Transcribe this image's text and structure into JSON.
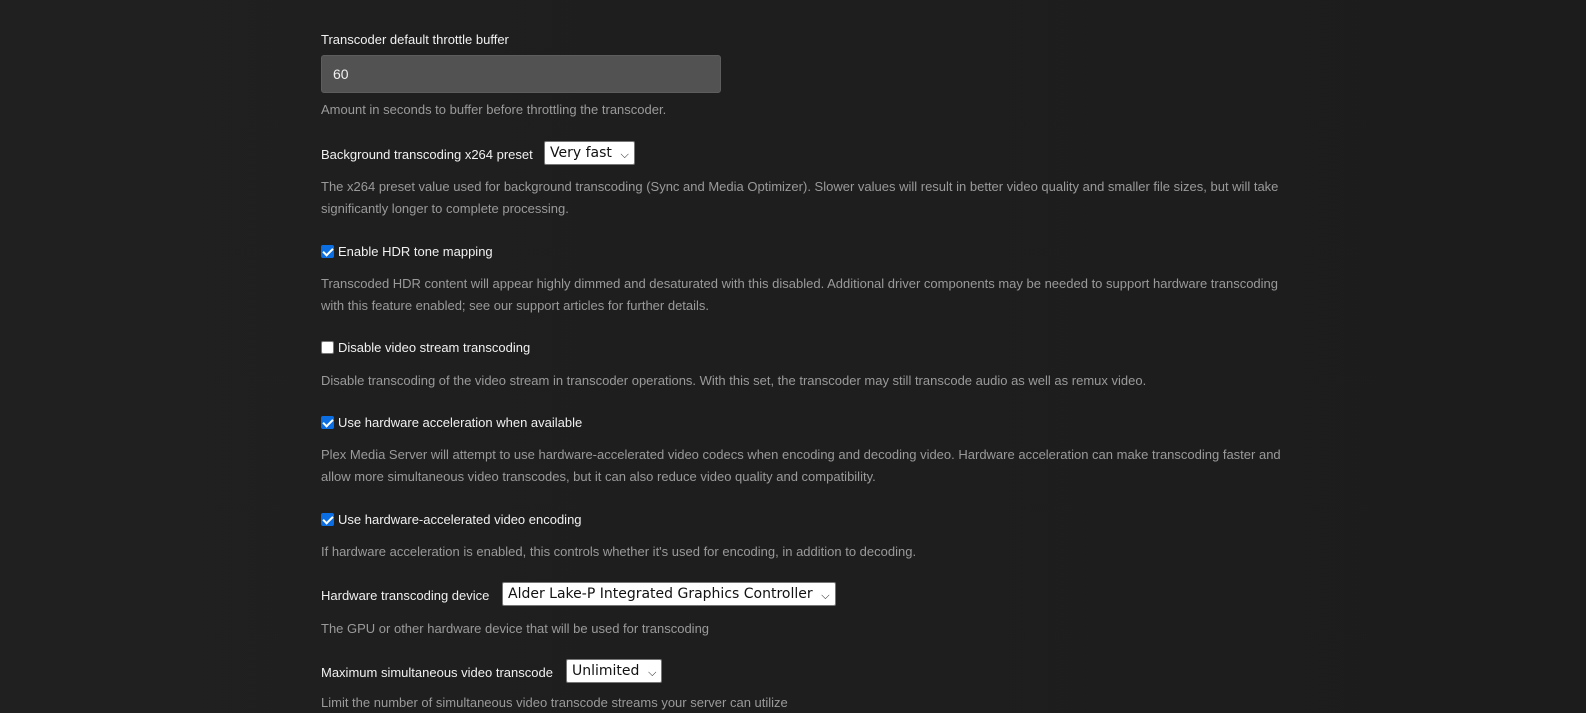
{
  "settings": {
    "throttle": {
      "label": "Transcoder default throttle buffer",
      "value": "60",
      "help": "Amount in seconds to buffer before throttling the transcoder."
    },
    "preset": {
      "label": "Background transcoding x264 preset",
      "selected": "Very fast",
      "help_line1": "The x264 preset value used for background transcoding (Sync and Media Optimizer). Slower values will result in better video quality and smaller file sizes, but will take",
      "help_line2": "significantly longer to complete processing."
    },
    "hdr": {
      "label": "Enable HDR tone mapping",
      "checked": true,
      "help_line1": "Transcoded HDR content will appear highly dimmed and desaturated with this disabled. Additional driver components may be needed to support hardware transcoding",
      "help_line2": "with this feature enabled; see our support articles for further details."
    },
    "disable_video": {
      "label": "Disable video stream transcoding",
      "checked": false,
      "help": "Disable transcoding of the video stream in transcoder operations. With this set, the transcoder may still transcode audio as well as remux video."
    },
    "hw_accel": {
      "label": "Use hardware acceleration when available",
      "checked": true,
      "help_line1": "Plex Media Server will attempt to use hardware-accelerated video codecs when encoding and decoding video. Hardware acceleration can make transcoding faster and",
      "help_line2": "allow more simultaneous video transcodes, but it can also reduce video quality and compatibility."
    },
    "hw_encode": {
      "label": "Use hardware-accelerated video encoding",
      "checked": true,
      "help": "If hardware acceleration is enabled, this controls whether it's used for encoding, in addition to decoding."
    },
    "hw_device": {
      "label": "Hardware transcoding device",
      "selected": "Alder Lake-P Integrated Graphics Controller",
      "help": "The GPU or other hardware device that will be used for transcoding"
    },
    "max_transcode": {
      "label": "Maximum simultaneous video transcode",
      "selected": "Unlimited",
      "help": "Limit the number of simultaneous video transcode streams your server can utilize"
    }
  },
  "icons": {
    "select_chevron": "chevron-down-icon"
  },
  "colors": {
    "background": "#1f1f1f",
    "input_bg": "#525252",
    "checkbox_accent": "#0b6ee3",
    "help_text": "#9a9a9a"
  }
}
